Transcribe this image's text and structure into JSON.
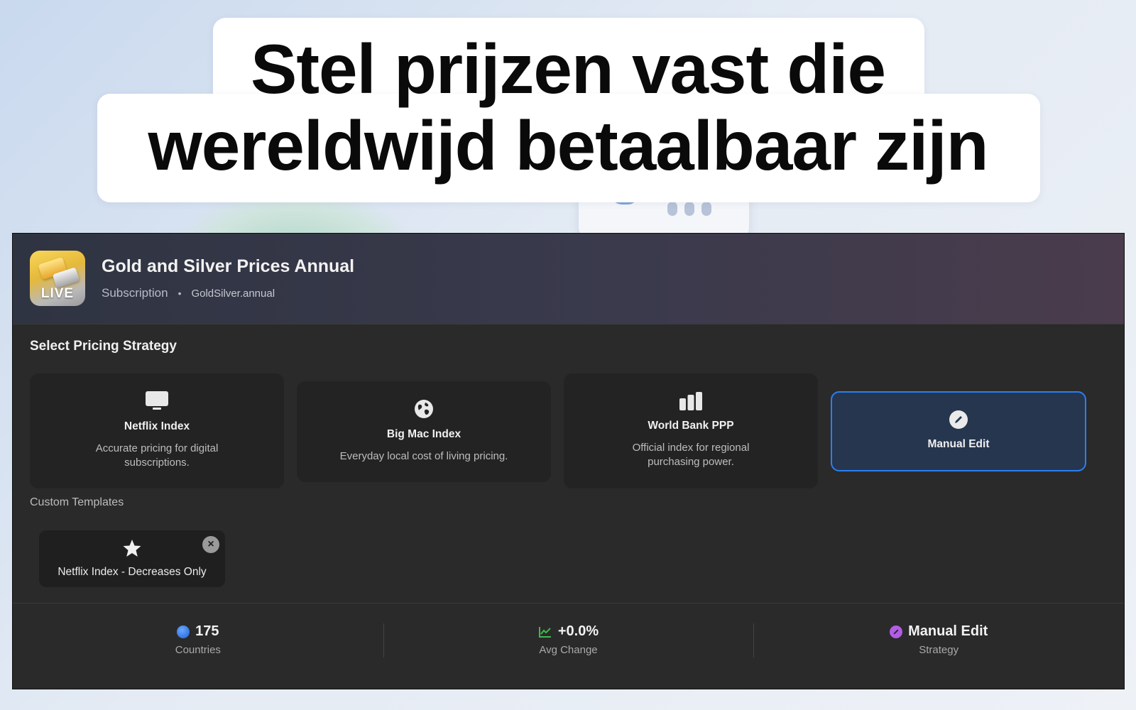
{
  "headline": {
    "line1": "Stel prijzen vast die",
    "line2": "wereldwijd betaalbaar zijn"
  },
  "app": {
    "icon_label": "LIVE",
    "title": "Gold and Silver Prices Annual",
    "type": "Subscription",
    "separator": "•",
    "product_id": "GoldSilver.annual"
  },
  "strategy": {
    "section_title": "Select Pricing Strategy",
    "options": [
      {
        "name": "Netflix Index",
        "description": "Accurate pricing for digital subscriptions.",
        "icon": "monitor-icon"
      },
      {
        "name": "Big Mac Index",
        "description": "Everyday local cost of living pricing.",
        "icon": "globe-icon"
      },
      {
        "name": "World Bank PPP",
        "description": "Official index for regional purchasing power.",
        "icon": "bar-chart-icon"
      },
      {
        "name": "Manual Edit",
        "description": "",
        "icon": "pencil-icon",
        "selected": true
      }
    ],
    "accent_color": "#2a7ff0"
  },
  "custom_templates": {
    "label": "Custom Templates",
    "items": [
      {
        "name": "Netflix Index - Decreases Only",
        "icon": "star-icon"
      }
    ]
  },
  "footer": {
    "stats": [
      {
        "value": "175",
        "label": "Countries",
        "icon": "globe-icon",
        "color": "#2f7be8"
      },
      {
        "value": "+0.0%",
        "label": "Avg Change",
        "icon": "trend-icon",
        "color": "#3fb950"
      },
      {
        "value": "Manual Edit",
        "label": "Strategy",
        "icon": "pencil-icon",
        "color": "#b35ce6"
      }
    ]
  }
}
